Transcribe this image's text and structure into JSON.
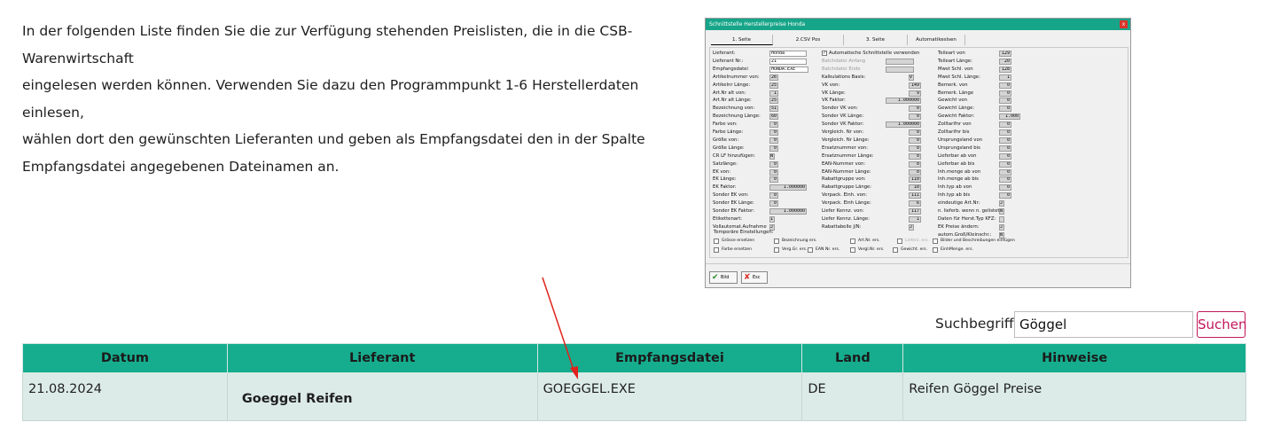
{
  "intro": {
    "line1": "In der folgenden Liste finden Sie die zur Verfügung stehenden Preislisten, die in die CSB-Warenwirtschaft",
    "line2": "eingelesen werden können. Verwenden Sie dazu den Programmpunkt 1-6 Herstellerdaten einlesen,",
    "line3": "wählen dort den gewünschten Lieferanten und geben als Empfangsdatei den in der Spalte",
    "line4": "Empfangsdatei angegebenen Dateinamen an."
  },
  "dialog": {
    "title": "Schnittstelle Herstellerpreise Honda",
    "close": "x",
    "tabs": [
      "1. Seite",
      "2.CSV Pos",
      "3. Seite",
      "Automatikeslsen"
    ],
    "col1": [
      {
        "label": "Lieferant:",
        "value": "Honda"
      },
      {
        "label": "Lieferant Nr.:",
        "value": "21"
      },
      {
        "label": "Empfangsdatei",
        "value": "HONDA.EXE"
      },
      {
        "label": "Artikelnummer von:",
        "value": "26"
      },
      {
        "label": "Artikelnr Länge:",
        "value": "25"
      },
      {
        "label": "Art.Nr alt von:",
        "value": "1"
      },
      {
        "label": "Art.Nr alt Länge:",
        "value": "25"
      },
      {
        "label": "Bezeichnung  von:",
        "value": "51"
      },
      {
        "label": "Bezeichnung Länge:",
        "value": "60"
      },
      {
        "label": "Farbe von:",
        "value": "0"
      },
      {
        "label": "Farbe Länge:",
        "value": "0"
      },
      {
        "label": "Größe von:",
        "value": "0"
      },
      {
        "label": "Größe Länge:",
        "value": "0"
      },
      {
        "label": "CR LF hinzufügen:",
        "value": "N"
      },
      {
        "label": "Satzlänge:",
        "value": "0"
      },
      {
        "label": "EK von:",
        "value": "0"
      },
      {
        "label": "EK Länge:",
        "value": "0"
      },
      {
        "label": "EK Faktor:",
        "value": "1.000000"
      },
      {
        "label": "Sonder EK von:",
        "value": "0"
      },
      {
        "label": "Sonder EK Länge:",
        "value": "0"
      },
      {
        "label": "Sonder EK Faktor:",
        "value": "1.000000"
      },
      {
        "label": "Etikettenart:",
        "value": "1"
      },
      {
        "label": "Vollautomat.Aufnahme",
        "value": "J"
      }
    ],
    "col2": [
      {
        "label": "Automatische Schnittstelle verwenden",
        "value": "✓"
      },
      {
        "label": "Batchdatei Anfang",
        "value": ""
      },
      {
        "label": "Batchdatei Ende",
        "value": ""
      },
      {
        "label": "Kalkulations Basis:",
        "value": "V"
      },
      {
        "label": "VK von:",
        "value": "149"
      },
      {
        "label": "VK Länge:",
        "value": "9"
      },
      {
        "label": "VK Faktor:",
        "value": "1.000000"
      },
      {
        "label": "Sonder VK von:",
        "value": "0"
      },
      {
        "label": "Sonder VK Länge:",
        "value": "0"
      },
      {
        "label": "Sonder VK Faktor:",
        "value": "1.000000"
      },
      {
        "label": "Vergleich. Nr von:",
        "value": "0"
      },
      {
        "label": "Vergleich. Nr Länge:",
        "value": "0"
      },
      {
        "label": "Ersatznummer  von:",
        "value": "0"
      },
      {
        "label": "Ersatznummer Länge:",
        "value": "0"
      },
      {
        "label": "EAN-Nummer    von:",
        "value": "0"
      },
      {
        "label": "EAN-Nummer  Länge:",
        "value": "0"
      },
      {
        "label": "Rabattgruppe  von:",
        "value": "110"
      },
      {
        "label": "Rabattgruppe  Länge:",
        "value": "10"
      },
      {
        "label": "Verpack. Einh. von:",
        "value": "111"
      },
      {
        "label": "Verpack. Einh Länge:",
        "value": "6"
      },
      {
        "label": "Liefer Kennz. von:",
        "value": "117"
      },
      {
        "label": "Liefer Kennz. Länge:",
        "value": "1"
      },
      {
        "label": "Rabattabelle J/N:",
        "value": "J"
      }
    ],
    "col3": [
      {
        "label": "Teileart von",
        "value": "129"
      },
      {
        "label": "Teileart Länge:",
        "value": "20"
      },
      {
        "label": "Mwst Schl. von",
        "value": "128"
      },
      {
        "label": "Mwst Schl. Länge:",
        "value": "1"
      },
      {
        "label": "Bemerk. von",
        "value": "0"
      },
      {
        "label": "Bemerk. Länge",
        "value": "0"
      },
      {
        "label": "Gewicht von",
        "value": "0"
      },
      {
        "label": "Gewicht Länge:",
        "value": "0"
      },
      {
        "label": "Gewicht Faktor:",
        "value": "1.000"
      },
      {
        "label": "Zolltarifnr von",
        "value": "0"
      },
      {
        "label": "Zolltarifnr bis",
        "value": "0"
      },
      {
        "label": "Ursprungsland von",
        "value": "0"
      },
      {
        "label": "Ursprungsland bis",
        "value": "0"
      },
      {
        "label": "Lieferbar ab von",
        "value": "0"
      },
      {
        "label": "Lieferbar ab bis",
        "value": "0"
      },
      {
        "label": "Inh.menge ab von",
        "value": "0"
      },
      {
        "label": "Inh.menge ab bis",
        "value": "0"
      },
      {
        "label": "Inh.typ ab von",
        "value": "0"
      },
      {
        "label": "Inh.typ ab bis",
        "value": "0"
      },
      {
        "label": "eindeutige Art.Nr:",
        "value": "J"
      },
      {
        "label": "n. lieferb. wenn n. gelistet:",
        "value": "N"
      },
      {
        "label": "Daten für Herst.Typ KFZ:",
        "value": ""
      },
      {
        "label": "EK Preise ändern:",
        "value": "J"
      },
      {
        "label": "autom.Groß/Kleinschr.:",
        "value": "N"
      }
    ],
    "temp_label": "Temporäre Einstellungen:",
    "checks_row1": [
      "Grösse ersetzen",
      "Bezeichnung ers.",
      "Art.Nr. ers.",
      "Lieferz. ers.",
      "Bilder und Beschreibungen einfügen"
    ],
    "checks_row2": [
      "Farbe ersetzen",
      "Verg.Gr. ers.",
      "EAN Nr. ers.",
      "Vergl.Nr. ers.",
      "Gewicht. ers.",
      "EinhMenge. ers."
    ],
    "btn_bild": "Bild",
    "btn_esc": "Esc"
  },
  "search": {
    "label": "Suchbegriff:",
    "value": "Göggel",
    "button": "Suchen"
  },
  "table": {
    "headers": [
      "Datum",
      "Lieferant",
      "Empfangsdatei",
      "Land",
      "Hinweise"
    ],
    "rows": [
      [
        "21.08.2024",
        "Goeggel Reifen",
        "GOEGGEL.EXE",
        "DE",
        "Reifen Göggel Preise"
      ]
    ]
  },
  "colors": {
    "accent": "#16ad8e",
    "row_bg": "#dcebe8",
    "search_button": "#c2185b",
    "arrow": "#e0221b"
  }
}
